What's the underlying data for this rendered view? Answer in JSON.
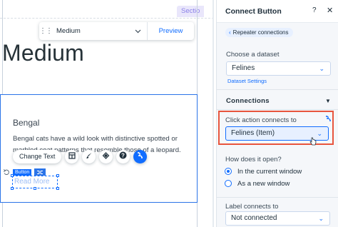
{
  "canvas": {
    "section_tag": "Sectio",
    "heading": "Medium",
    "font_toolbar": {
      "font_value": "Medium",
      "preview_label": "Preview"
    },
    "item": {
      "title": "Bengal",
      "description": "Bengal cats have a wild look with distinctive spotted or marbled coat patterns that resemble those of a leopard."
    },
    "actions": {
      "change_text_label": "Change Text",
      "icons": [
        "layout-icon",
        "design-brush-icon",
        "animation-icon",
        "help-icon",
        "connect-data-icon"
      ]
    },
    "button_tag": "Button",
    "button_text": "Read More"
  },
  "panel": {
    "title": "Connect Button",
    "help": "?",
    "close": "✕",
    "back_label": "Repeater connections",
    "dataset": {
      "label": "Choose a dataset",
      "value": "Felines",
      "settings_link": "Dataset Settings"
    },
    "connections": {
      "section_title": "Connections",
      "click_action": {
        "label": "Click action connects to",
        "value": "Felines (Item)"
      },
      "open_mode": {
        "label": "How does it open?",
        "options": [
          {
            "label": "In the current window",
            "selected": true
          },
          {
            "label": "As a new window",
            "selected": false
          }
        ]
      },
      "label_connects": {
        "label": "Label connects to",
        "value": "Not connected"
      }
    }
  },
  "colors": {
    "accent": "#116dff",
    "highlight": "#e8553e",
    "selection": "#2b74e8",
    "section_tag_bg": "#e9e6fb"
  }
}
